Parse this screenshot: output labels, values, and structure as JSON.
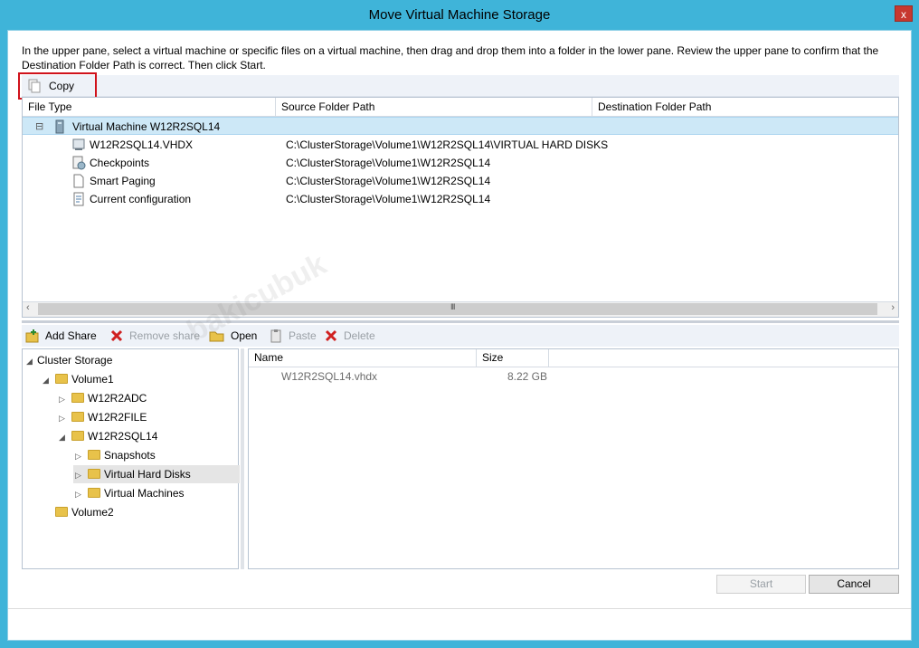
{
  "window": {
    "title": "Move Virtual Machine Storage",
    "close_glyph": "x"
  },
  "instructions": "In the upper pane, select a virtual machine or specific files on a virtual machine, then drag and drop them into a folder in the lower pane.  Review the upper pane to confirm that the Destination Folder Path is correct. Then click Start.",
  "copy_toolbar": {
    "copy_label": "Copy"
  },
  "upper_grid": {
    "columns": [
      "File Type",
      "Source Folder Path",
      "Destination Folder Path"
    ],
    "vm_row": {
      "expander": "⊟",
      "label": "Virtual Machine W12R2SQL14"
    },
    "rows": [
      {
        "name": "W12R2SQL14.VHDX",
        "source": "C:\\ClusterStorage\\Volume1\\W12R2SQL14\\VIRTUAL HARD DISKS",
        "icon": "vhd-icon"
      },
      {
        "name": "Checkpoints",
        "source": "C:\\ClusterStorage\\Volume1\\W12R2SQL14",
        "icon": "checkpoint-icon"
      },
      {
        "name": "Smart Paging",
        "source": "C:\\ClusterStorage\\Volume1\\W12R2SQL14",
        "icon": "document-icon"
      },
      {
        "name": "Current configuration",
        "source": "C:\\ClusterStorage\\Volume1\\W12R2SQL14",
        "icon": "config-icon"
      }
    ],
    "scroll_mid_glyph": "III"
  },
  "share_toolbar": {
    "add_share": "Add Share",
    "remove_share": "Remove share",
    "open": "Open",
    "paste": "Paste",
    "delete": "Delete"
  },
  "tree": {
    "root": "Cluster Storage",
    "volume1": "Volume1",
    "w12r2adc": "W12R2ADC",
    "w12r2file": "W12R2FILE",
    "w12r2sql14": "W12R2SQL14",
    "snapshots": "Snapshots",
    "virtual_hard_disks": "Virtual Hard Disks",
    "virtual_machines": "Virtual Machines",
    "volume2": "Volume2"
  },
  "files": {
    "columns": [
      "Name",
      "Size"
    ],
    "rows": [
      {
        "name": "W12R2SQL14.vhdx",
        "size": "8.22 GB"
      }
    ]
  },
  "buttons": {
    "start": "Start",
    "cancel": "Cancel"
  },
  "watermark": "bakicubuk",
  "colors": {
    "titlebar": "#3fb4d9",
    "selected_row": "#cde8f7",
    "highlight_box": "#d0121b",
    "close_button": "#c7382f"
  }
}
